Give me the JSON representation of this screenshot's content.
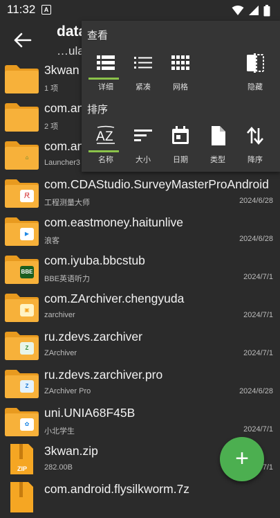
{
  "status": {
    "time": "11:32",
    "notif_letter": "A"
  },
  "header": {
    "title": "data",
    "subtitle": "…ula"
  },
  "popup": {
    "view_title": "查看",
    "view_options": [
      {
        "label": "详细",
        "icon": "list-detail-icon",
        "selected": true
      },
      {
        "label": "紧凑",
        "icon": "list-compact-icon",
        "selected": false
      },
      {
        "label": "网格",
        "icon": "grid-icon",
        "selected": false
      },
      {
        "label": "隐藏",
        "icon": "hide-panel-icon",
        "selected": false
      }
    ],
    "sort_title": "排序",
    "sort_options": [
      {
        "label": "名称",
        "icon": "sort-az-icon",
        "selected": true
      },
      {
        "label": "大小",
        "icon": "sort-size-icon",
        "selected": false
      },
      {
        "label": "日期",
        "icon": "calendar-icon",
        "selected": false
      },
      {
        "label": "类型",
        "icon": "file-type-icon",
        "selected": false
      },
      {
        "label": "降序",
        "icon": "sort-desc-icon",
        "selected": false
      }
    ]
  },
  "files": [
    {
      "name": "3kwan",
      "sub": "1 项",
      "date": "",
      "kind": "folder",
      "badge": ""
    },
    {
      "name": "com.an",
      "sub": "2 项",
      "date": "",
      "kind": "folder",
      "badge": ""
    },
    {
      "name": "com.an",
      "sub": "Launcher3",
      "date": "",
      "kind": "folder",
      "badge": "home"
    },
    {
      "name": "com.CDAStudio.SurveyMasterProAndroid",
      "sub": "工程测量大师",
      "date": "2024/6/28",
      "kind": "folder",
      "badge": "survey"
    },
    {
      "name": "com.eastmoney.haitunlive",
      "sub": "浪客",
      "date": "2024/6/28",
      "kind": "folder",
      "badge": "play"
    },
    {
      "name": "com.iyuba.bbcstub",
      "sub": "BBE英语听力",
      "date": "2024/7/1",
      "kind": "folder",
      "badge": "BBE"
    },
    {
      "name": "com.ZArchiver.chengyuda",
      "sub": "zarchiver",
      "date": "2024/7/1",
      "kind": "folder",
      "badge": "za"
    },
    {
      "name": "ru.zdevs.zarchiver",
      "sub": "ZArchiver",
      "date": "2024/7/1",
      "kind": "folder",
      "badge": "zarch"
    },
    {
      "name": "ru.zdevs.zarchiver.pro",
      "sub": "ZArchiver Pro",
      "date": "2024/6/28",
      "kind": "folder",
      "badge": "zarchpro"
    },
    {
      "name": "uni.UNIA68F45B",
      "sub": "小北学生",
      "date": "2024/7/1",
      "kind": "folder",
      "badge": "uni"
    },
    {
      "name": "3kwan.zip",
      "sub": "282.00B",
      "date": "2024/7/1",
      "kind": "zip",
      "badge": "ZIP"
    },
    {
      "name": "com.android.flysilkworm.7z",
      "sub": "",
      "date": "",
      "kind": "zip",
      "badge": ""
    }
  ],
  "fab": {
    "label": "+"
  },
  "colors": {
    "accent": "#8bc34a",
    "folder": "#f5a623",
    "fab": "#4caf50"
  }
}
